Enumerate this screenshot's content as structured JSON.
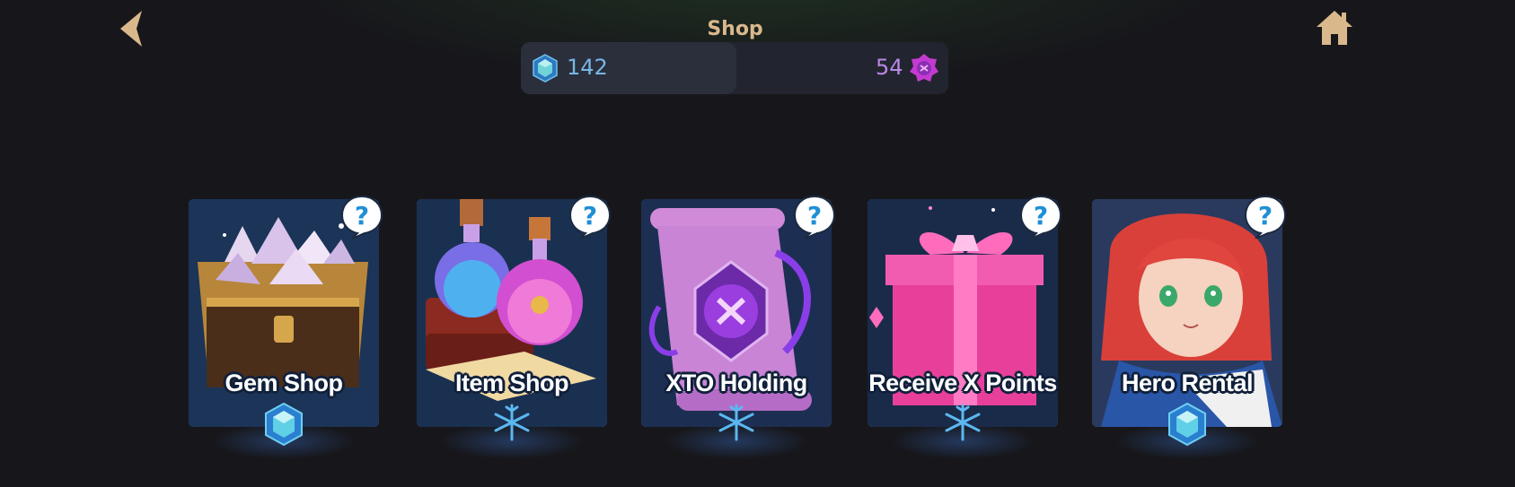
{
  "header": {
    "title": "Shop",
    "back_icon": "chevron-left-icon",
    "home_icon": "home-icon"
  },
  "currency": {
    "blue_gems": {
      "icon": "blue-gem-icon",
      "count": "142",
      "color": "#78b6e6"
    },
    "pink_gems": {
      "icon": "pink-gem-icon",
      "count": "54",
      "color": "#b888e6"
    }
  },
  "cards": [
    {
      "id": "gem-shop",
      "label": "Gem Shop",
      "art": "treasure-chest-crystals",
      "badge": "blue-gem-icon"
    },
    {
      "id": "item-shop",
      "label": "Item Shop",
      "art": "potions-and-books",
      "badge": "snowflake-icon"
    },
    {
      "id": "xto-holding",
      "label": "XTO Holding",
      "art": "purple-scroll-emblem",
      "badge": "snowflake-icon"
    },
    {
      "id": "receive-x-points",
      "label": "Receive X Points",
      "art": "pink-gift-box",
      "badge": "snowflake-icon"
    },
    {
      "id": "hero-rental",
      "label": "Hero Rental",
      "art": "red-haired-hero-portrait",
      "badge": "blue-gem-icon"
    }
  ],
  "colors": {
    "accent_gold": "#d9b88c",
    "background": "#17171b",
    "card_blue": "#22508e",
    "help_blue": "#1f8fd6"
  }
}
